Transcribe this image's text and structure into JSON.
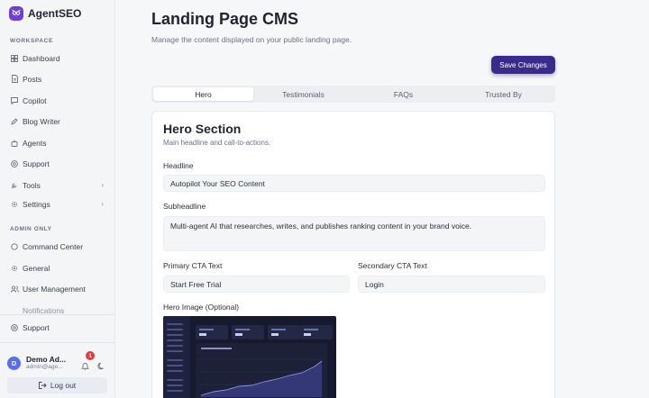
{
  "brand": {
    "name": "AgentSEO",
    "accent": "#6d3fd6"
  },
  "sidebar": {
    "workspace_label": "WORKSPACE",
    "admin_label": "ADMIN ONLY",
    "workspace_items": [
      {
        "label": "Dashboard",
        "icon": "dashboard-icon"
      },
      {
        "label": "Posts",
        "icon": "document-icon"
      },
      {
        "label": "Copilot",
        "icon": "chat-icon"
      },
      {
        "label": "Blog Writer",
        "icon": "pen-icon"
      },
      {
        "label": "Agents",
        "icon": "bot-icon"
      },
      {
        "label": "Support",
        "icon": "help-icon"
      },
      {
        "label": "Tools",
        "icon": "wrench-icon"
      },
      {
        "label": "Settings",
        "icon": "gear-icon"
      }
    ],
    "admin_items": [
      {
        "label": "Command Center",
        "icon": "target-icon"
      },
      {
        "label": "General",
        "icon": "gear-icon"
      },
      {
        "label": "User Management",
        "icon": "users-icon"
      },
      {
        "label": "Notifications",
        "icon": "bell-icon"
      }
    ],
    "support_label": "Support",
    "user": {
      "initial": "D",
      "name": "Demo Ad...",
      "email": "admin@age...",
      "notification_count": "1"
    },
    "logout_label": "Log out"
  },
  "main": {
    "title": "Landing Page CMS",
    "subtitle": "Manage the content displayed on your public landing page.",
    "save_label": "Save Changes",
    "tabs": [
      "Hero",
      "Testimonials",
      "FAQs",
      "Trusted By"
    ],
    "active_tab": "Hero",
    "card": {
      "title": "Hero Section",
      "subtitle": "Main headline and call-to-actions.",
      "headline_label": "Headline",
      "headline_value": "Autopilot Your SEO Content",
      "subheadline_label": "Subheadline",
      "subheadline_value": "Multi-agent AI that researches, writes, and publishes ranking content in your brand voice.",
      "primary_cta_label": "Primary CTA Text",
      "primary_cta_value": "Start Free Trial",
      "secondary_cta_label": "Secondary CTA Text",
      "secondary_cta_value": "Login",
      "hero_image_label": "Hero Image (Optional)"
    }
  }
}
